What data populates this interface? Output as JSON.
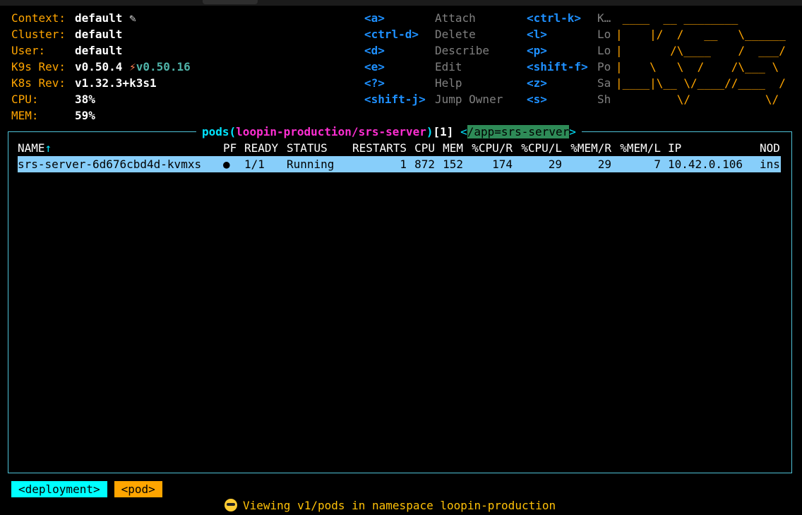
{
  "info": [
    {
      "key": "Context:",
      "value": "default",
      "extra": "✎"
    },
    {
      "key": "Cluster:",
      "value": "default"
    },
    {
      "key": "User:",
      "value": "default"
    },
    {
      "key": "K9s Rev:",
      "value": "v0.50.4",
      "latest": "v0.50.16"
    },
    {
      "key": "K8s Rev:",
      "value": "v1.32.3+k3s1"
    },
    {
      "key": "CPU:",
      "value": "38%"
    },
    {
      "key": "MEM:",
      "value": "59%"
    }
  ],
  "shortcuts_col1": [
    {
      "key": "<a>",
      "action": "Attach"
    },
    {
      "key": "<ctrl-d>",
      "action": "Delete"
    },
    {
      "key": "<d>",
      "action": "Describe"
    },
    {
      "key": "<e>",
      "action": "Edit"
    },
    {
      "key": "<?>",
      "action": "Help"
    },
    {
      "key": "<shift-j>",
      "action": "Jump Owner"
    }
  ],
  "shortcuts_col2": [
    {
      "key": "<ctrl-k>",
      "action": "K…"
    },
    {
      "key": "<l>",
      "action": "Lo"
    },
    {
      "key": "<p>",
      "action": "Lo"
    },
    {
      "key": "<shift-f>",
      "action": "Po"
    },
    {
      "key": "<z>",
      "action": "Sa"
    },
    {
      "key": "<s>",
      "action": "Sh"
    }
  ],
  "logo_lines": [
    " ____  __ ________",
    "|    |/  /   __   \\______",
    "|       /\\____    /  ___/",
    "|    \\   \\  /    /\\___ \\",
    "|____|\\__ \\/____//____  /",
    "         \\/           \\/"
  ],
  "view": {
    "resource": "pods",
    "namespace_path": "loopin-production/srs-server",
    "count": "[1]",
    "filter_open": "<",
    "filter": "/app=srs-server",
    "filter_close": ">"
  },
  "table": {
    "sort_arrow": "↑",
    "headers": {
      "name": "NAME",
      "pf": "PF",
      "ready": "READY",
      "status": "STATUS",
      "restarts": "RESTARTS",
      "cpu": "CPU",
      "mem": "MEM",
      "cpu_r": "%CPU/R",
      "cpu_l": "%CPU/L",
      "mem_r": "%MEM/R",
      "mem_l": "%MEM/L",
      "ip": "IP",
      "node": "NOD"
    },
    "rows": [
      {
        "name": "srs-server-6d676cbd4d-kvmxs",
        "pf": "●",
        "ready": "1/1",
        "status": "Running",
        "restarts": "1",
        "cpu": "872",
        "mem": "152",
        "cpu_r": "174",
        "cpu_l": "29",
        "mem_r": "29",
        "mem_l": "7",
        "ip": "10.42.0.106",
        "node": "ins"
      }
    ]
  },
  "crumbs": {
    "deployment": "<deployment>",
    "pod": "<pod>"
  },
  "status": "Viewing v1/pods in namespace loopin-production",
  "colors": {
    "accent": "#ffa500",
    "key": "#1e90ff",
    "selected_row": "#87cefa",
    "frame": "#4fc3d8"
  }
}
